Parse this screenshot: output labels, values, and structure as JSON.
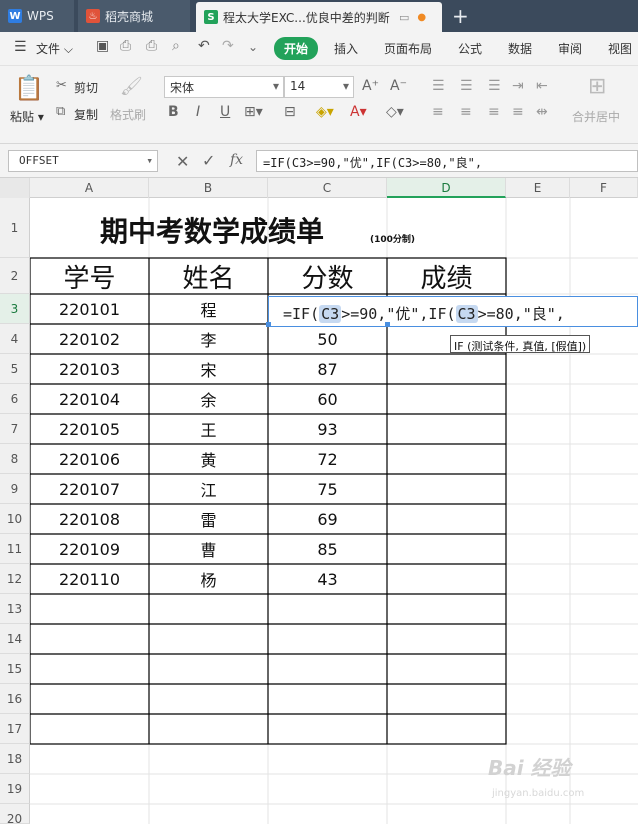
{
  "tabs": [
    {
      "label": "WPS",
      "icon": "wps-logo-icon"
    },
    {
      "label": "稻壳商城",
      "icon": "docer-flame-icon"
    },
    {
      "label": "程太大学EXC...优良中差的判断",
      "icon": "spreadsheet-icon"
    }
  ],
  "menubar": {
    "file_label": "文件",
    "items": [
      "开始",
      "插入",
      "页面布局",
      "公式",
      "数据",
      "审阅",
      "视图"
    ]
  },
  "ribbon": {
    "paste_label": "粘贴",
    "cut_label": "剪切",
    "copy_label": "复制",
    "format_painter_label": "格式刷",
    "font_name": "宋体",
    "font_size": "14",
    "merge_label": "合并居中"
  },
  "formula_bar": {
    "name_box": "OFFSET",
    "fx_label": "fx",
    "formula": "=IF(C3>=90,\"优\",IF(C3>=80,\"良\","
  },
  "columns": [
    "A",
    "B",
    "C",
    "D",
    "E",
    "F"
  ],
  "rows": [
    "1",
    "2",
    "3",
    "4",
    "5",
    "6",
    "7",
    "8",
    "9",
    "10",
    "11",
    "12",
    "13",
    "14",
    "15",
    "16",
    "17",
    "18",
    "19",
    "20"
  ],
  "sheet": {
    "title": "期中考数学成绩单",
    "subtitle": "(100分制)",
    "headers": [
      "学号",
      "姓名",
      "分数",
      "成绩"
    ],
    "records": [
      {
        "id": "220101",
        "name": "程",
        "score": ""
      },
      {
        "id": "220102",
        "name": "李",
        "score": "50"
      },
      {
        "id": "220103",
        "name": "宋",
        "score": "87"
      },
      {
        "id": "220104",
        "name": "余",
        "score": "60"
      },
      {
        "id": "220105",
        "name": "王",
        "score": "93"
      },
      {
        "id": "220106",
        "name": "黄",
        "score": "72"
      },
      {
        "id": "220107",
        "name": "江",
        "score": "75"
      },
      {
        "id": "220108",
        "name": "雷",
        "score": "69"
      },
      {
        "id": "220109",
        "name": "曹",
        "score": "85"
      },
      {
        "id": "220110",
        "name": "杨",
        "score": "43"
      }
    ]
  },
  "cell_editor": {
    "p1": "=IF(",
    "ref1": "C3",
    "p2": ">=90,\"优\",IF(",
    "ref2": "C3",
    "p3": ">=80,\"良\","
  },
  "tooltip": "IF (测试条件, 真值, [假值])",
  "watermark": {
    "main": "Bai 经验",
    "sub": "jingyan.baidu.com"
  },
  "colors": {
    "accent": "#22a25a",
    "titlebar": "#3b4a5c",
    "ref_highlight": "#c6d9f1"
  }
}
